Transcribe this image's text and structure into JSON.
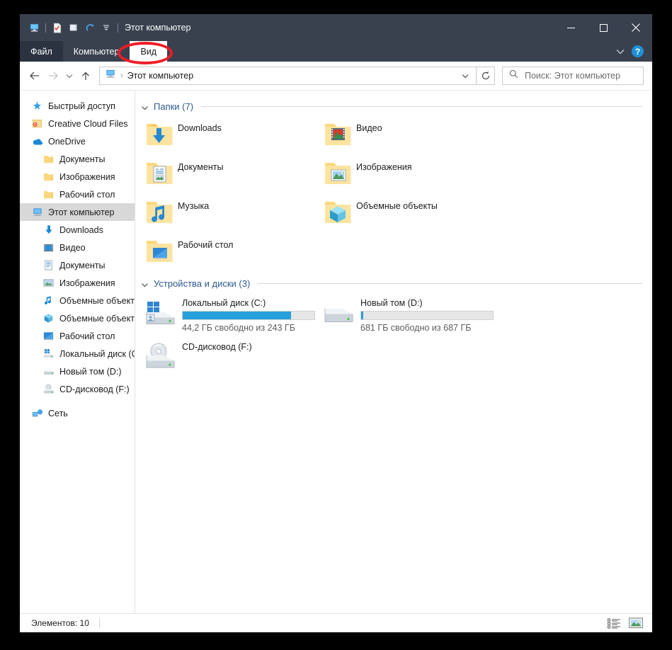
{
  "window": {
    "title": "Этот компьютер",
    "quick_access": [
      {
        "name": "this-pc-icon",
        "label": "Этот компьютер"
      },
      {
        "name": "properties-icon",
        "label": "Свойства"
      },
      {
        "name": "new-folder-icon",
        "label": "Создать папку"
      },
      {
        "name": "redo-icon",
        "label": "Вернуть"
      },
      {
        "name": "customize-qat-icon",
        "label": "Настройка панели быстрого доступа"
      }
    ],
    "controls": {
      "minimize": "—",
      "maximize": "□",
      "close": "✕"
    }
  },
  "ribbon": {
    "tabs": [
      {
        "label": "Файл",
        "active": false,
        "kind": "file"
      },
      {
        "label": "Компьютер",
        "active": false,
        "kind": "normal"
      },
      {
        "label": "Вид",
        "active": true,
        "kind": "normal"
      }
    ],
    "expand_icon": "chevron-down-icon",
    "help_label": "?",
    "annotation": {
      "target": "Вид",
      "color": "#ee1c25",
      "shape": "ellipse"
    }
  },
  "navigation": {
    "back_label": "Назад",
    "forward_label": "Вперед",
    "recent_label": "Последние расположения",
    "up_label": "Вверх",
    "breadcrumb": {
      "icon": "this-pc-icon",
      "path": "Этот компьютер",
      "separator": "›"
    },
    "dropdown_label": "Предыдущие расположения",
    "refresh_label": "Обновить"
  },
  "search": {
    "placeholder": "Поиск: Этот компьютер",
    "icon": "search-icon"
  },
  "sidebar": {
    "items": [
      {
        "label": "Быстрый доступ",
        "icon": "pin-star-icon",
        "indent": false,
        "selected": false
      },
      {
        "label": "Creative Cloud Files",
        "icon": "creative-cloud-icon",
        "indent": false,
        "selected": false
      },
      {
        "label": "OneDrive",
        "icon": "onedrive-cloud-icon",
        "indent": false,
        "selected": false
      },
      {
        "label": "Документы",
        "icon": "folder-icon",
        "indent": true,
        "selected": false
      },
      {
        "label": "Изображения",
        "icon": "folder-icon",
        "indent": true,
        "selected": false
      },
      {
        "label": "Рабочий стол",
        "icon": "folder-icon",
        "indent": true,
        "selected": false
      },
      {
        "label": "Этот компьютер",
        "icon": "this-pc-icon",
        "indent": false,
        "selected": true
      },
      {
        "label": "Downloads",
        "icon": "downloads-icon",
        "indent": true,
        "selected": false
      },
      {
        "label": "Видео",
        "icon": "video-icon",
        "indent": true,
        "selected": false
      },
      {
        "label": "Документы",
        "icon": "documents-icon",
        "indent": true,
        "selected": false
      },
      {
        "label": "Изображения",
        "icon": "pictures-icon",
        "indent": true,
        "selected": false
      },
      {
        "label": "Музыка",
        "icon": "music-icon",
        "indent": true,
        "selected": false
      },
      {
        "label": "Объемные объекты",
        "icon": "3d-objects-icon",
        "indent": true,
        "selected": false
      },
      {
        "label": "Рабочий стол",
        "icon": "desktop-icon",
        "indent": true,
        "selected": false
      },
      {
        "label": "Локальный диск (C:)",
        "icon": "windows-drive-icon",
        "indent": true,
        "selected": false
      },
      {
        "label": "Новый том (D:)",
        "icon": "drive-icon",
        "indent": true,
        "selected": false
      },
      {
        "label": "CD-дисковод (F:)",
        "icon": "cd-drive-icon",
        "indent": true,
        "selected": false
      },
      {
        "label": "Сеть",
        "icon": "network-icon",
        "indent": false,
        "selected": false,
        "gap_before": true
      }
    ]
  },
  "content": {
    "folders_group": {
      "title": "Папки (7)",
      "collapsed": false,
      "items": [
        {
          "label": "Downloads",
          "icon": "folder-downloads-icon"
        },
        {
          "label": "Видео",
          "icon": "folder-video-icon"
        },
        {
          "label": "Документы",
          "icon": "folder-documents-icon"
        },
        {
          "label": "Изображения",
          "icon": "folder-pictures-icon"
        },
        {
          "label": "Музыка",
          "icon": "folder-music-icon"
        },
        {
          "label": "Объемные объекты",
          "icon": "folder-3d-icon"
        },
        {
          "label": "Рабочий стол",
          "icon": "folder-desktop-icon"
        }
      ]
    },
    "drives_group": {
      "title": "Устройства и диски (3)",
      "collapsed": false,
      "items": [
        {
          "label": "Локальный диск (C:)",
          "icon": "windows-drive-icon",
          "free_text": "44,2 ГБ свободно из 243 ГБ",
          "free_gb": 44.2,
          "total_gb": 243,
          "used_percent": 82,
          "has_bar": true,
          "bar_color": "#26a0da"
        },
        {
          "label": "Новый том (D:)",
          "icon": "drive-icon",
          "free_text": "681 ГБ свободно из 687 ГБ",
          "free_gb": 681,
          "total_gb": 687,
          "used_percent": 1,
          "has_bar": true,
          "bar_color": "#26a0da"
        },
        {
          "label": "CD-дисковод (F:)",
          "icon": "cd-drive-icon",
          "free_text": "",
          "has_bar": false
        }
      ]
    }
  },
  "statusbar": {
    "items_text": "Элементов: 10",
    "views": [
      {
        "name": "details-view-button",
        "label": "Крупные значки",
        "active": false
      },
      {
        "name": "large-icons-view-button",
        "label": "Таблица",
        "active": true
      }
    ]
  }
}
